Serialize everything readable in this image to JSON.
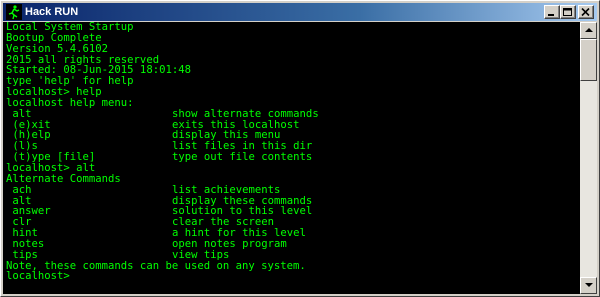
{
  "window": {
    "title": "Hack RUN",
    "icon": "running-man-icon"
  },
  "colors": {
    "console_bg": "#000000",
    "console_text": "#00ff00",
    "titlebar_start": "#0a246a",
    "titlebar_end": "#a6caf0"
  },
  "console": {
    "lines": [
      "Local System Startup",
      "Bootup Complete",
      "Version 5.4.6102",
      "2015 all rights reserved",
      "Started: 08-Jun-2015 18:01:48",
      "type 'help' for help",
      "localhost> help",
      "localhost help menu:",
      "",
      "",
      "",
      "",
      "",
      "localhost> alt",
      "Alternate Commands",
      "",
      "",
      "",
      "",
      "",
      "",
      "",
      "Note, these commands can be used on any system.",
      "localhost>"
    ],
    "help_menu": [
      {
        "cmd": " alt",
        "desc": "show alternate commands"
      },
      {
        "cmd": " (e)xit",
        "desc": "exits this localhost"
      },
      {
        "cmd": " (h)elp",
        "desc": "display this menu"
      },
      {
        "cmd": " (l)s",
        "desc": "list files in this dir"
      },
      {
        "cmd": " (t)ype [file]",
        "desc": "type out file contents"
      }
    ],
    "alt_commands": [
      {
        "cmd": " ach",
        "desc": "list achievements"
      },
      {
        "cmd": " alt",
        "desc": "display these commands"
      },
      {
        "cmd": " answer",
        "desc": "solution to this level"
      },
      {
        "cmd": " clr",
        "desc": "clear the screen"
      },
      {
        "cmd": " hint",
        "desc": "a hint for this level"
      },
      {
        "cmd": " notes",
        "desc": "open notes program"
      },
      {
        "cmd": " tips",
        "desc": "view tips"
      }
    ]
  }
}
